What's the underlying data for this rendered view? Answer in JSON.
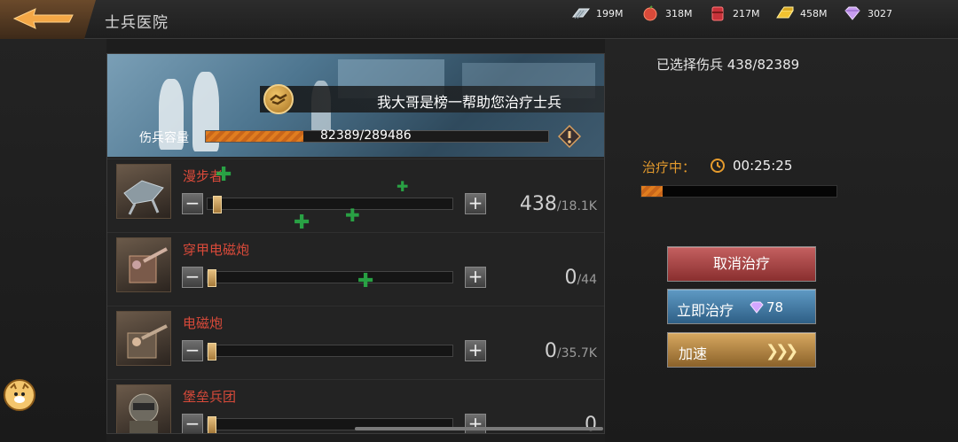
{
  "header": {
    "title": "士兵医院",
    "resources": [
      {
        "icon": "steel-icon",
        "value": "199M",
        "color": "#b8c4cc"
      },
      {
        "icon": "food-icon",
        "value": "318M",
        "color": "#d94a3a"
      },
      {
        "icon": "oil-icon",
        "value": "217M",
        "color": "#c8323a"
      },
      {
        "icon": "gold-icon",
        "value": "458M",
        "color": "#f2c230"
      },
      {
        "icon": "diamond-icon",
        "value": "3027",
        "color": "#c79cf0"
      }
    ]
  },
  "banner": {
    "help_text": "我大哥是榜一帮助您治疗士兵",
    "capacity_label": "伤兵容量",
    "capacity_text": "82389/289486",
    "capacity_fraction": 0.2846
  },
  "units": [
    {
      "name": "漫步者",
      "count": "438",
      "max": "/18.1K",
      "fraction": 0.024
    },
    {
      "name": "穿甲电磁炮",
      "count": "0",
      "max": "/44",
      "fraction": 0
    },
    {
      "name": "电磁炮",
      "count": "0",
      "max": "/35.7K",
      "fraction": 0
    },
    {
      "name": "堡垒兵团",
      "count": "0",
      "max": "",
      "fraction": 0
    }
  ],
  "right": {
    "selected": "已选择伤兵  438/82389",
    "healing_label": "治疗中：",
    "timer": "00:25:25",
    "heal_fraction": 0.11,
    "cancel_label": "取消治疗",
    "instant_label": "立即治疗",
    "instant_cost": "78",
    "speed_label": "加速"
  }
}
